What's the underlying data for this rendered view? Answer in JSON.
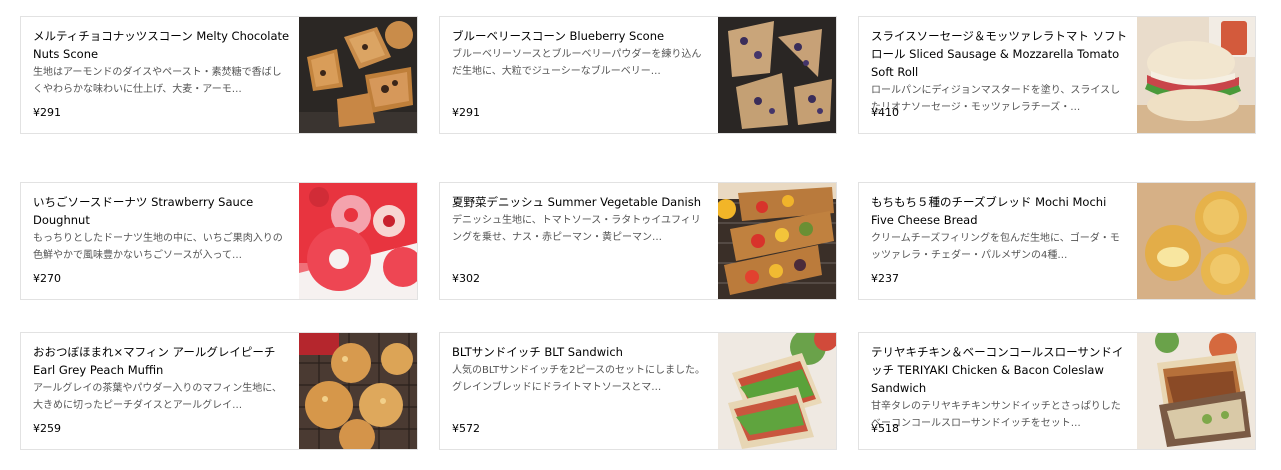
{
  "menu_items": [
    {
      "title": "メルティチョコナッツスコーン Melty Chocolate Nuts Scone",
      "description": "生地はアーモンドのダイスやペースト・素焚糖で香ばしくやわらかな味わいに仕上げ、大麦・アーモ…",
      "price": "¥291",
      "image_icon": "scone-image"
    },
    {
      "title": "ブルーベリースコーン Blueberry Scone",
      "description": "ブルーベリーソースとブルーベリーパウダーを練り込んだ生地に、大粒でジューシーなブルーベリー…",
      "price": "¥291",
      "image_icon": "blueberry-scone-image"
    },
    {
      "title": "スライスソーセージ＆モッツァレラトマト ソフトロール Sliced Sausage & Mozzarella Tomato Soft Roll",
      "description": "ロールパンにディジョンマスタードを塗り、スライスしたリオナソーセージ・モッツァレラチーズ・…",
      "price": "¥410",
      "image_icon": "soft-roll-image"
    },
    {
      "title": "いちごソースドーナツ Strawberry Sauce Doughnut",
      "description": "もっちりとしたドーナツ生地の中に、いちご果肉入りの色鮮やかで風味豊かないちごソースが入って…",
      "price": "¥270",
      "image_icon": "doughnut-image"
    },
    {
      "title": "夏野菜デニッシュ Summer Vegetable Danish",
      "description": "デニッシュ生地に、トマトソース・ラタトゥイユフィリングを乗せ、ナス・赤ピーマン・黄ピーマン…",
      "price": "¥302",
      "image_icon": "danish-image"
    },
    {
      "title": "もちもち５種のチーズブレッド Mochi Mochi Five Cheese Bread",
      "description": "クリームチーズフィリングを包んだ生地に、ゴーダ・モッツァレラ・チェダー・パルメザンの4種…",
      "price": "¥237",
      "image_icon": "cheese-bread-image"
    },
    {
      "title": "おおつぼほまれ×マフィン アールグレイピーチ Earl Grey Peach Muffin",
      "description": "アールグレイの茶葉やパウダー入りのマフィン生地に、大きめに切ったピーチダイスとアールグレイ…",
      "price": "¥259",
      "image_icon": "muffin-image"
    },
    {
      "title": "BLTサンドイッチ BLT Sandwich",
      "description": "人気のBLTサンドイッチを2ピースのセットにしました。グレインブレッドにドライトマトソースとマ…",
      "price": "¥572",
      "image_icon": "blt-sandwich-image"
    },
    {
      "title": "テリヤキチキン＆ベーコンコールスローサンドイッチ TERIYAKI Chicken & Bacon Coleslaw Sandwich",
      "description": "甘辛タレのテリヤキチキンサンドイッチとさっぱりしたベーコンコールスローサンドイッチをセット…",
      "price": "¥518",
      "image_icon": "teriyaki-sandwich-image"
    }
  ]
}
